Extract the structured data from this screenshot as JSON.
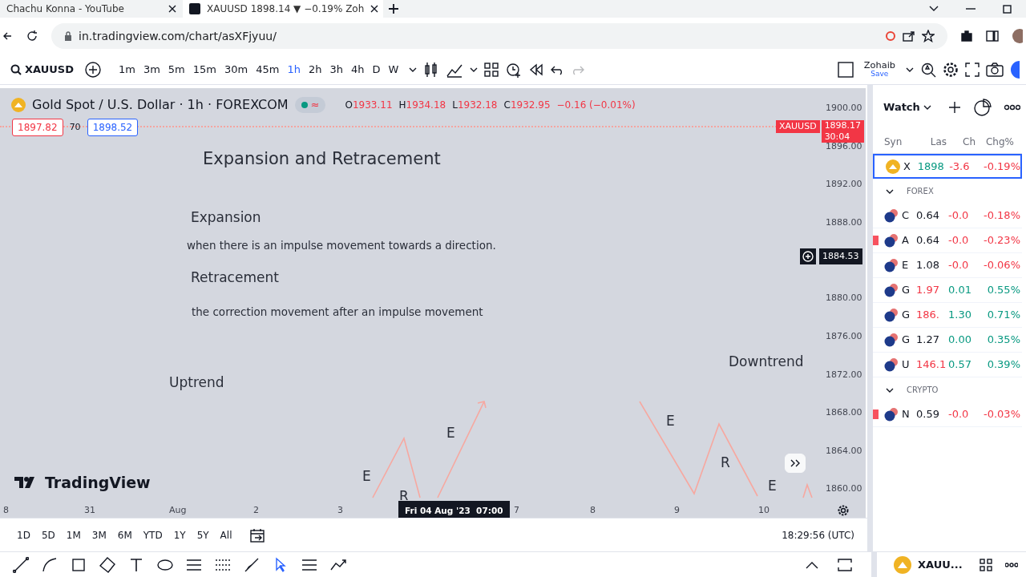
{
  "browser": {
    "tabs": [
      {
        "title": "Chachu Konna - YouTube",
        "selected": false
      },
      {
        "title": "XAUUSD 1898.14 ▼ −0.19% Zoh",
        "selected": true
      }
    ],
    "url": "in.tradingview.com/chart/asXFjyuu/"
  },
  "toolbar": {
    "symbol": "XAUUSD",
    "intervals": [
      {
        "label": "1m",
        "selected": false
      },
      {
        "label": "3m",
        "selected": false
      },
      {
        "label": "5m",
        "selected": false
      },
      {
        "label": "15m",
        "selected": false
      },
      {
        "label": "30m",
        "selected": false
      },
      {
        "label": "45m",
        "selected": false
      },
      {
        "label": "1h",
        "selected": true
      },
      {
        "label": "2h",
        "selected": false
      },
      {
        "label": "3h",
        "selected": false
      },
      {
        "label": "4h",
        "selected": false
      },
      {
        "label": "D",
        "selected": false
      },
      {
        "label": "W",
        "selected": false
      }
    ],
    "user": "Zohaib",
    "save": "Save"
  },
  "legend": {
    "title": "Gold Spot / U.S. Dollar · 1h · FOREXCOM",
    "status": "≈",
    "ohlc": [
      {
        "key": "O",
        "value": "1933.11"
      },
      {
        "key": "H",
        "value": "1934.18"
      },
      {
        "key": "L",
        "value": "1932.18"
      },
      {
        "key": "C",
        "value": "1932.95"
      }
    ],
    "change": "−0.16 (−0.01%)"
  },
  "quote": {
    "bid": "1897.82",
    "spread": "70",
    "ask": "1898.52"
  },
  "notes": [
    {
      "kind": "title",
      "text": "Expansion and Retracement"
    },
    {
      "kind": "heading",
      "text": "Expansion"
    },
    {
      "kind": "body",
      "text": "when there is an impulse movement towards a direction."
    },
    {
      "kind": "heading",
      "text": "Retracement"
    },
    {
      "kind": "body",
      "text": "the correction movement after an impulse movement"
    },
    {
      "kind": "heading",
      "text": "Uptrend"
    },
    {
      "kind": "heading",
      "text": "Downtrend"
    }
  ],
  "wave_labels": [
    "E",
    "R",
    "E",
    "E",
    "R",
    "E"
  ],
  "price_axis": [
    "1900.00",
    "1896.00",
    "1892.00",
    "1888.00",
    "1880.00",
    "1876.00",
    "1872.00",
    "1868.00",
    "1864.00",
    "1860.00"
  ],
  "price_tag": {
    "symbol": "XAUUSD",
    "price": "1898.17",
    "countdown": "30:04"
  },
  "crosshair": {
    "price": "1884.53",
    "time": "Fri 04 Aug '23  07:00"
  },
  "time_axis": [
    "8",
    "31",
    "Aug",
    "2",
    "3",
    "7",
    "8",
    "9",
    "10"
  ],
  "brand": "TradingView",
  "range": {
    "buttons": [
      "1D",
      "5D",
      "1M",
      "3M",
      "6M",
      "YTD",
      "1Y",
      "5Y",
      "All"
    ],
    "clock": "18:29:56 (UTC)"
  },
  "watchlist": {
    "title": "Watch",
    "columns": [
      "Syn",
      "Las",
      "Ch",
      "Chg%"
    ],
    "items": [
      {
        "kind": "metal",
        "symbol": "X",
        "last": {
          "text": "1898",
          "color": "#089981"
        },
        "change": {
          "text": "-3.6",
          "color": "#f23645"
        },
        "change_pct": {
          "text": "-0.19%",
          "color": "#f23645"
        },
        "flagged": false,
        "selected": true
      },
      {
        "kind": "group",
        "label": "FOREX",
        "expanded": true
      },
      {
        "kind": "pair",
        "symbol": "C",
        "last": {
          "text": "0.64",
          "color": "#131722"
        },
        "change": {
          "text": "-0.0",
          "color": "#f23645"
        },
        "change_pct": {
          "text": "-0.18%",
          "color": "#f23645"
        },
        "flagged": false,
        "selected": false
      },
      {
        "kind": "pair",
        "symbol": "A",
        "last": {
          "text": "0.64",
          "color": "#131722"
        },
        "change": {
          "text": "-0.0",
          "color": "#f23645"
        },
        "change_pct": {
          "text": "-0.23%",
          "color": "#f23645"
        },
        "flagged": true,
        "selected": false
      },
      {
        "kind": "pair",
        "symbol": "E",
        "last": {
          "text": "1.08",
          "color": "#131722"
        },
        "change": {
          "text": "-0.0",
          "color": "#f23645"
        },
        "change_pct": {
          "text": "-0.06%",
          "color": "#f23645"
        },
        "flagged": false,
        "selected": false
      },
      {
        "kind": "pair",
        "symbol": "G",
        "last": {
          "text": "1.97",
          "color": "#f23645"
        },
        "change": {
          "text": "0.01",
          "color": "#089981"
        },
        "change_pct": {
          "text": "0.55%",
          "color": "#089981"
        },
        "flagged": false,
        "selected": false
      },
      {
        "kind": "pair",
        "symbol": "G",
        "last": {
          "text": "186.",
          "color": "#f23645"
        },
        "change": {
          "text": "1.30",
          "color": "#089981"
        },
        "change_pct": {
          "text": "0.71%",
          "color": "#089981"
        },
        "flagged": false,
        "selected": false
      },
      {
        "kind": "pair",
        "symbol": "G",
        "last": {
          "text": "1.27",
          "color": "#131722"
        },
        "change": {
          "text": "0.00",
          "color": "#089981"
        },
        "change_pct": {
          "text": "0.35%",
          "color": "#089981"
        },
        "flagged": false,
        "selected": false
      },
      {
        "kind": "pair",
        "symbol": "U",
        "last": {
          "text": "146.1",
          "color": "#f23645"
        },
        "change": {
          "text": "0.57",
          "color": "#089981"
        },
        "change_pct": {
          "text": "0.39%",
          "color": "#089981"
        },
        "flagged": false,
        "selected": false
      },
      {
        "kind": "group",
        "label": "CRYPTO",
        "expanded": true
      },
      {
        "kind": "pair",
        "symbol": "N",
        "last": {
          "text": "0.59",
          "color": "#131722"
        },
        "change": {
          "text": "-0.0",
          "color": "#f23645"
        },
        "change_pct": {
          "text": "-0.03%",
          "color": "#f23645"
        },
        "flagged": true,
        "selected": false
      }
    ]
  },
  "footer": {
    "symbol": "XAUU..."
  }
}
